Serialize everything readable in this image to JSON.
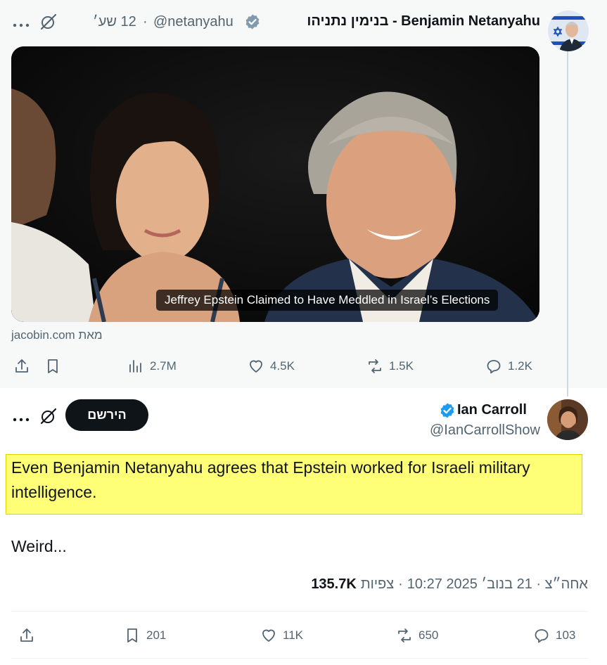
{
  "quoted": {
    "display_name": "בנימין נתניהו - Benjamin Netanyahu",
    "handle": "@netanyahu",
    "separator": "·",
    "time": "12 שע׳",
    "media_caption": "Jeffrey Epstein Claimed to Have Meddled in Israel’s Elections",
    "link_source": "מאת jacobin.com",
    "stats": {
      "views": "2.7M",
      "likes": "4.5K",
      "reposts": "1.5K",
      "replies": "1.2K"
    }
  },
  "main": {
    "display_name": "Ian Carroll",
    "handle": "@IanCarrollShow",
    "subscribe_label": "הירשם",
    "text_highlighted": "Even Benjamin Netanyahu agrees that Epstein worked for Israeli military intelligence.",
    "text_followup": "Weird...",
    "meta": {
      "time": "10:27 2025 אחה״צ · 21 בנוב׳",
      "separator": "·",
      "views_count": "135.7K",
      "views_label": "צפיות"
    },
    "stats": {
      "bookmarks": "201",
      "likes": "11K",
      "reposts": "650",
      "replies": "103"
    }
  },
  "icons": {
    "more": "more-icon",
    "grok": "grok-icon",
    "verified": "verified-badge-icon",
    "share": "share-icon",
    "bookmark": "bookmark-icon",
    "views": "views-icon",
    "like": "heart-icon",
    "repost": "repost-icon",
    "reply": "reply-icon"
  },
  "colors": {
    "verified_gray": "#829aab",
    "verified_blue": "#1d9bf0",
    "highlight": "#ffff77",
    "quoted_background": "#f7f9f9"
  }
}
